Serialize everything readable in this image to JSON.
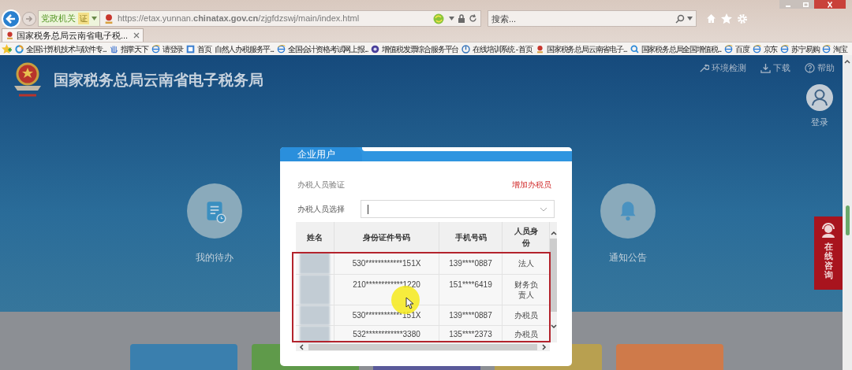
{
  "address_bar": {
    "badge": "党政机关",
    "cert": "证",
    "url": "https://etax.yunnan.**chinatax.gov.cn**/zjgfdzswj/main/index.html"
  },
  "search": {
    "placeholder": "搜索..."
  },
  "tabs": [
    {
      "label": "国家税务总局云南省电子税...",
      "selected": true
    }
  ],
  "favorites": [
    {
      "label": "全国计算机技术与软件专...",
      "kind": "compass"
    },
    {
      "label": "指掌天下",
      "kind": "hand"
    },
    {
      "label": "请登录",
      "kind": "ie"
    },
    {
      "label": "首页",
      "kind": "app"
    },
    {
      "label": "自然人办税服务平...",
      "kind": "none"
    },
    {
      "label": "全国会计资格考试网上报...",
      "kind": "ie"
    },
    {
      "label": "增值税发票综合服务平台",
      "kind": "disc"
    },
    {
      "label": "在线培训系统 - 首页",
      "kind": "power"
    },
    {
      "label": "国家税务总局云南省电子...",
      "kind": "emblem"
    },
    {
      "label": "国家税务总局全国增值税...",
      "kind": "magnifier"
    },
    {
      "label": "百度",
      "kind": "ie"
    },
    {
      "label": "京东",
      "kind": "ie"
    },
    {
      "label": "苏宁易购",
      "kind": "ie"
    },
    {
      "label": "淘宝",
      "kind": "ie"
    }
  ],
  "site": {
    "title": "国家税务总局云南省电子税务局",
    "top_links": [
      {
        "label": "环境检测",
        "kind": "wrench"
      },
      {
        "label": "下载",
        "kind": "download"
      },
      {
        "label": "帮助",
        "kind": "help"
      }
    ],
    "login": "登录",
    "tiles": [
      {
        "label": "我的待办",
        "kind": "todo"
      },
      {
        "label": "通知公告",
        "kind": "bell"
      }
    ],
    "consult": "在线咨询"
  },
  "dialog": {
    "tab": "企业用户",
    "section": "办税人员验证",
    "add_link": "增加办税员",
    "select_label": "办税人员选择",
    "table": {
      "columns": [
        "姓名",
        "身份证件号码",
        "手机号码",
        "人员身份"
      ],
      "rows": [
        {
          "id_number": "530************151X",
          "phone": "139****0887",
          "role": "法人"
        },
        {
          "id_number": "210************1220",
          "phone": "151****6419",
          "role": "财务负责人"
        },
        {
          "id_number": "530************151X",
          "phone": "139****0887",
          "role": "办税员"
        },
        {
          "id_number": "532************3380",
          "phone": "135****2373",
          "role": "办税员"
        }
      ]
    }
  }
}
